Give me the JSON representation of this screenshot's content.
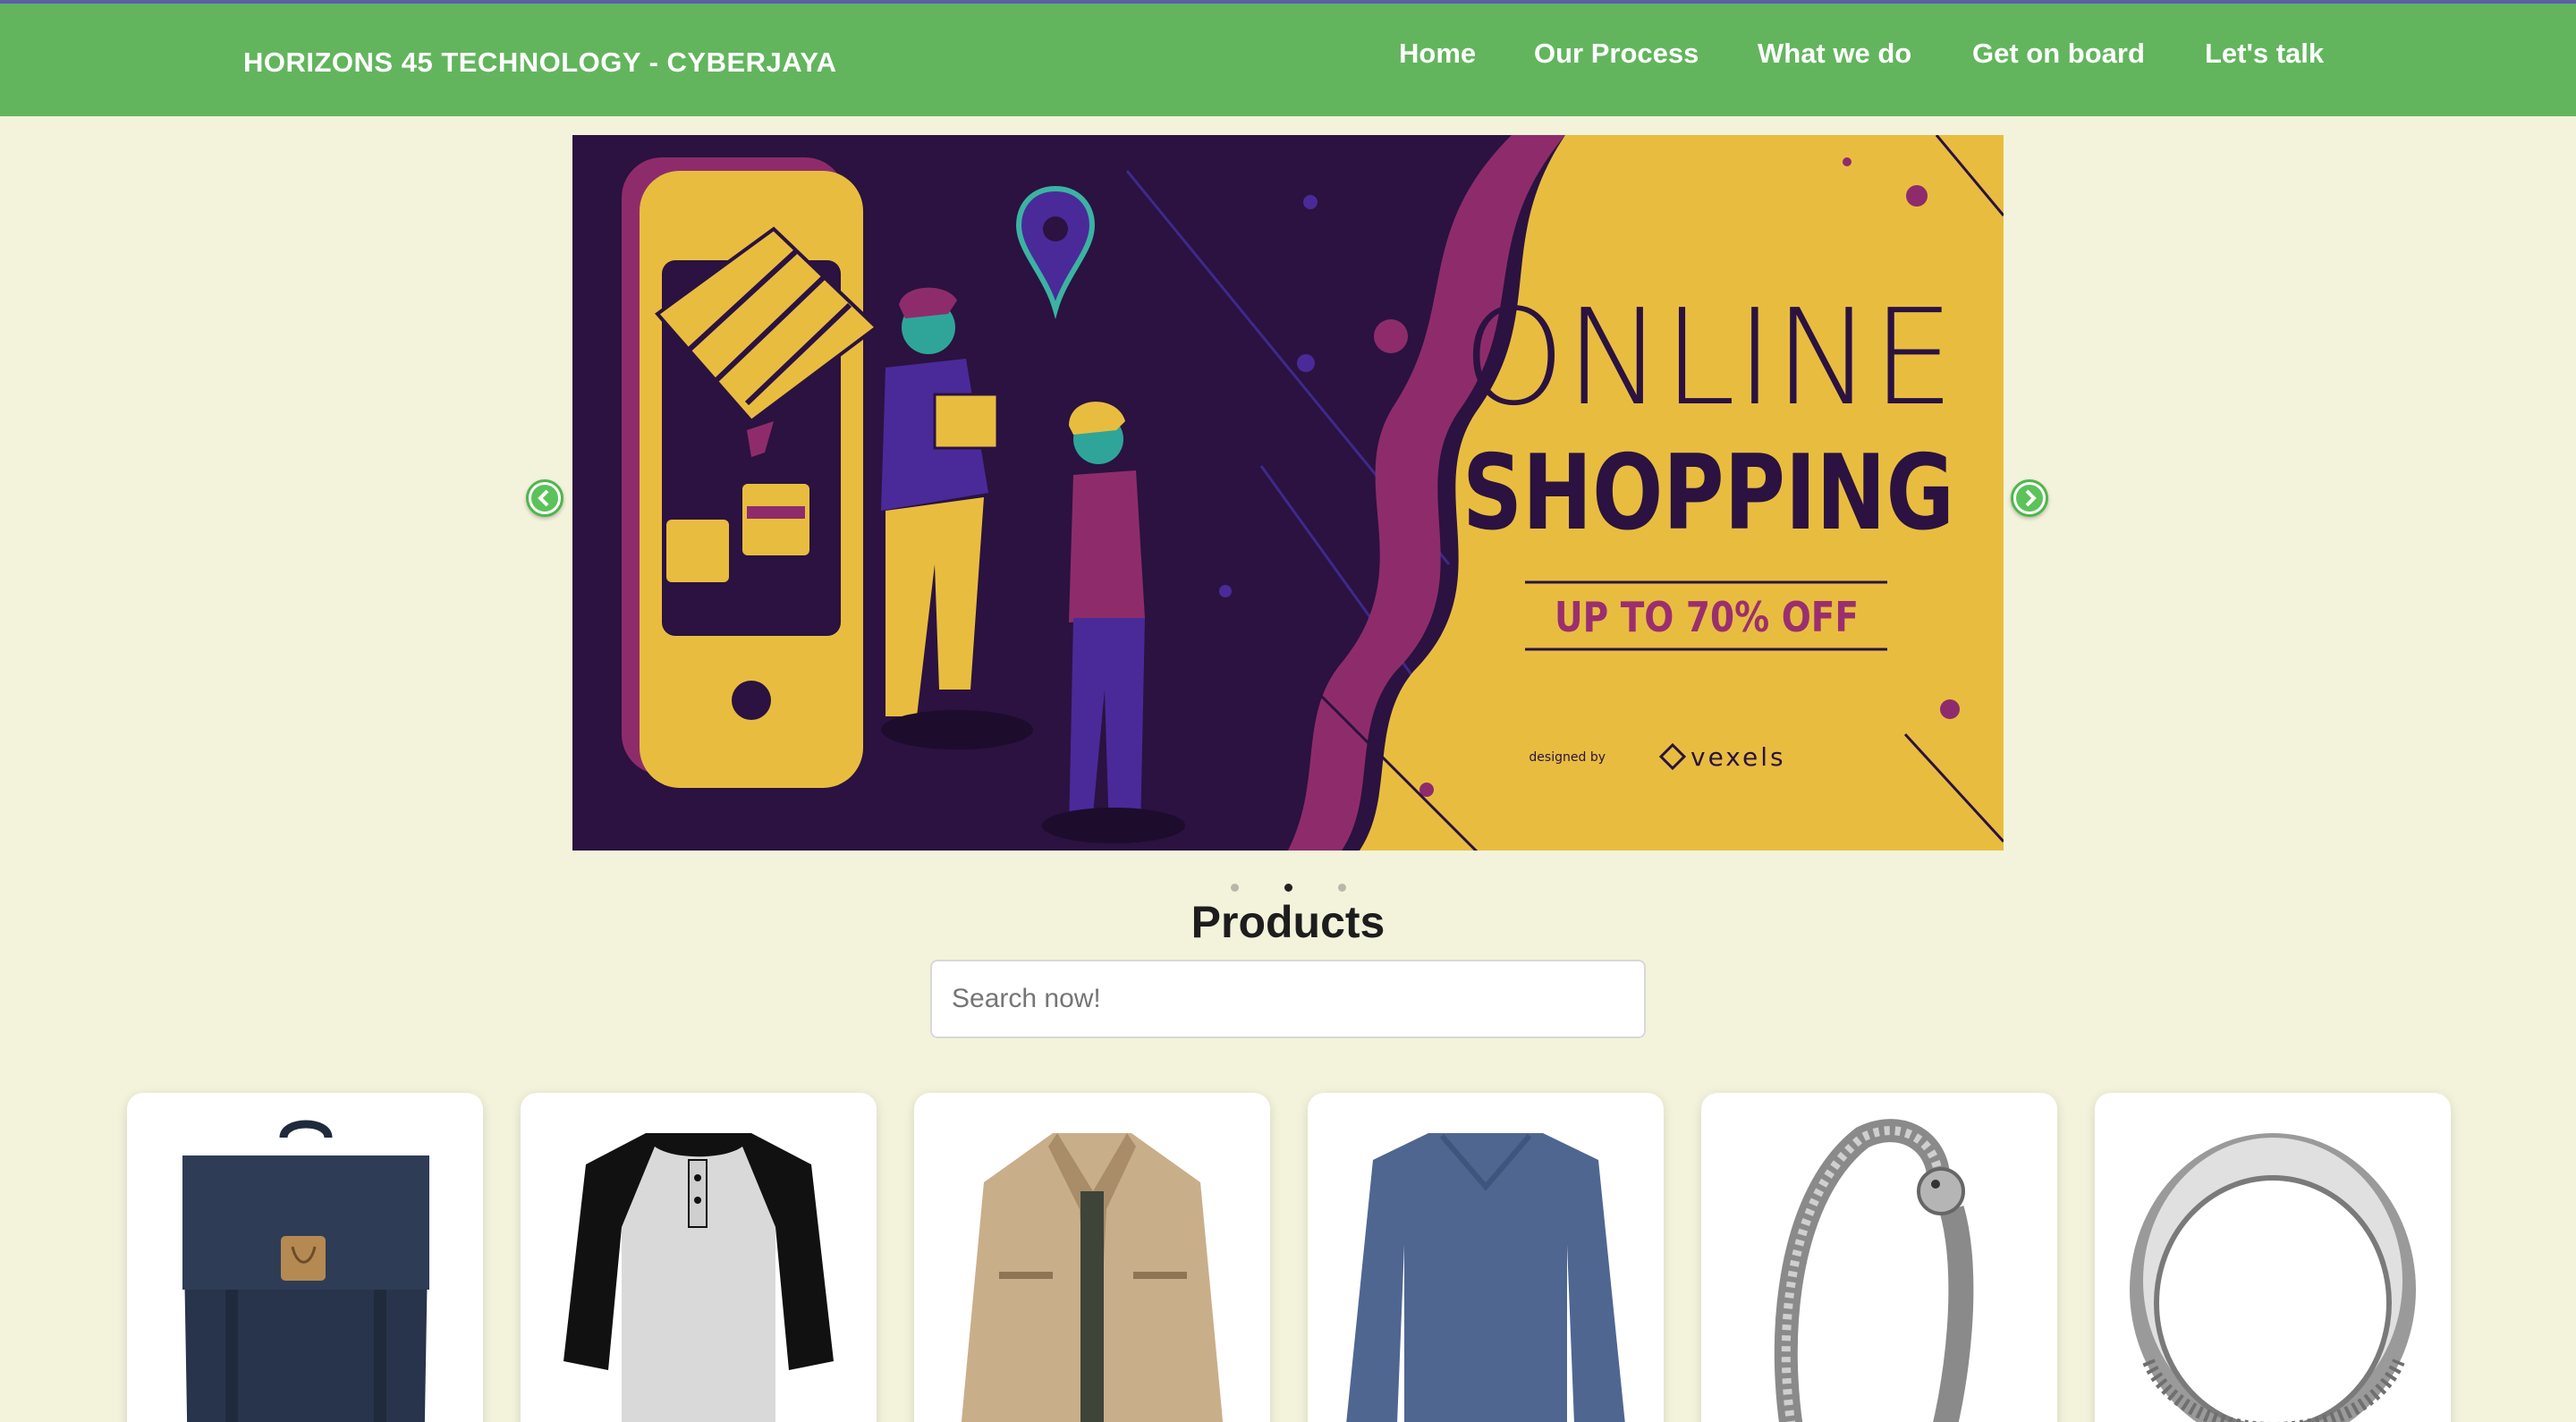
{
  "header": {
    "brand": "HORIZONS 45 TECHNOLOGY - CYBERJAYA",
    "nav": [
      {
        "label": "Home"
      },
      {
        "label": "Our Process"
      },
      {
        "label": "What we do"
      },
      {
        "label": "Get on board"
      },
      {
        "label": "Let's talk"
      }
    ]
  },
  "carousel": {
    "slide": {
      "headline_line1": "ONLINE",
      "headline_line2": "SHOPPING",
      "offer": "UP TO 70% OFF",
      "credit_prefix": "designed by",
      "credit_brand": "vexels"
    },
    "prev_icon": "chevron-left-icon",
    "next_icon": "chevron-right-icon",
    "slide_count": 3,
    "active_index": 1
  },
  "products": {
    "title": "Products",
    "search_placeholder": "Search now!",
    "items": [
      {
        "image": "backpack-image"
      },
      {
        "image": "raglan-shirt-image"
      },
      {
        "image": "jacket-image"
      },
      {
        "image": "long-sleeve-shirt-image"
      },
      {
        "image": "dragon-bracelet-image"
      },
      {
        "image": "silver-ring-image"
      }
    ]
  },
  "colors": {
    "header_bg": "#62b55d",
    "page_bg": "#f3f3dc",
    "banner_purple": "#2b1240",
    "banner_yellow": "#e8bd3f",
    "offer_magenta": "#9b2f6e"
  }
}
